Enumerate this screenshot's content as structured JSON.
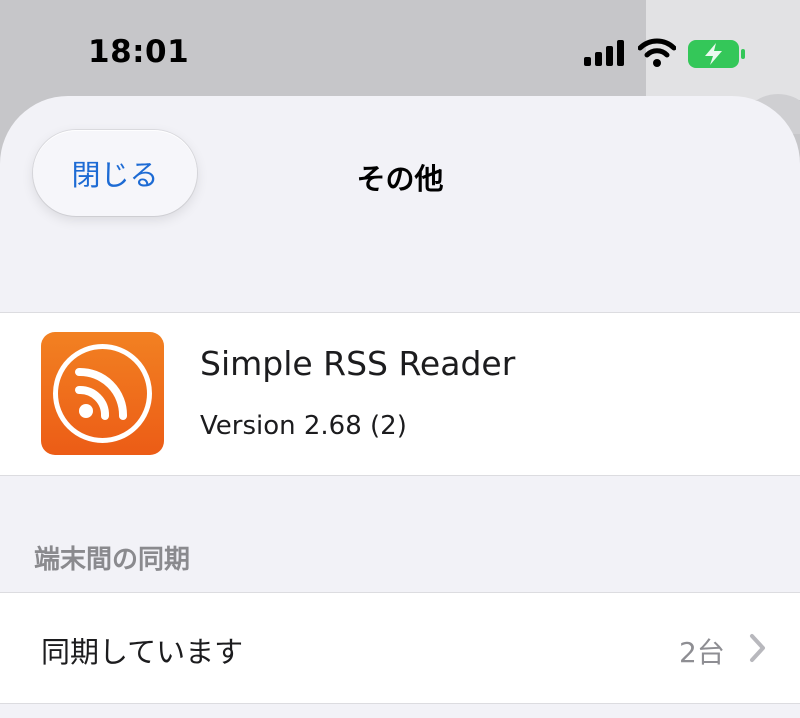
{
  "status_bar": {
    "time": "18:01",
    "icons": [
      "signal-icon",
      "wifi-icon",
      "battery-charging-icon"
    ],
    "battery_color": "#34c759"
  },
  "nav": {
    "close_label": "閉じる",
    "title": "その他"
  },
  "app_info": {
    "name": "Simple RSS Reader",
    "version": "Version 2.68 (2)",
    "icon": "rss-icon",
    "icon_color": "#ef6c1b"
  },
  "sync_section": {
    "header": "端末間の同期",
    "row_label": "同期しています",
    "row_value": "2台",
    "row_icon": "chevron-right-icon"
  },
  "colors": {
    "accent": "#1d6bd4",
    "background": "#f2f2f7",
    "secondary_text": "#8e8e93"
  }
}
